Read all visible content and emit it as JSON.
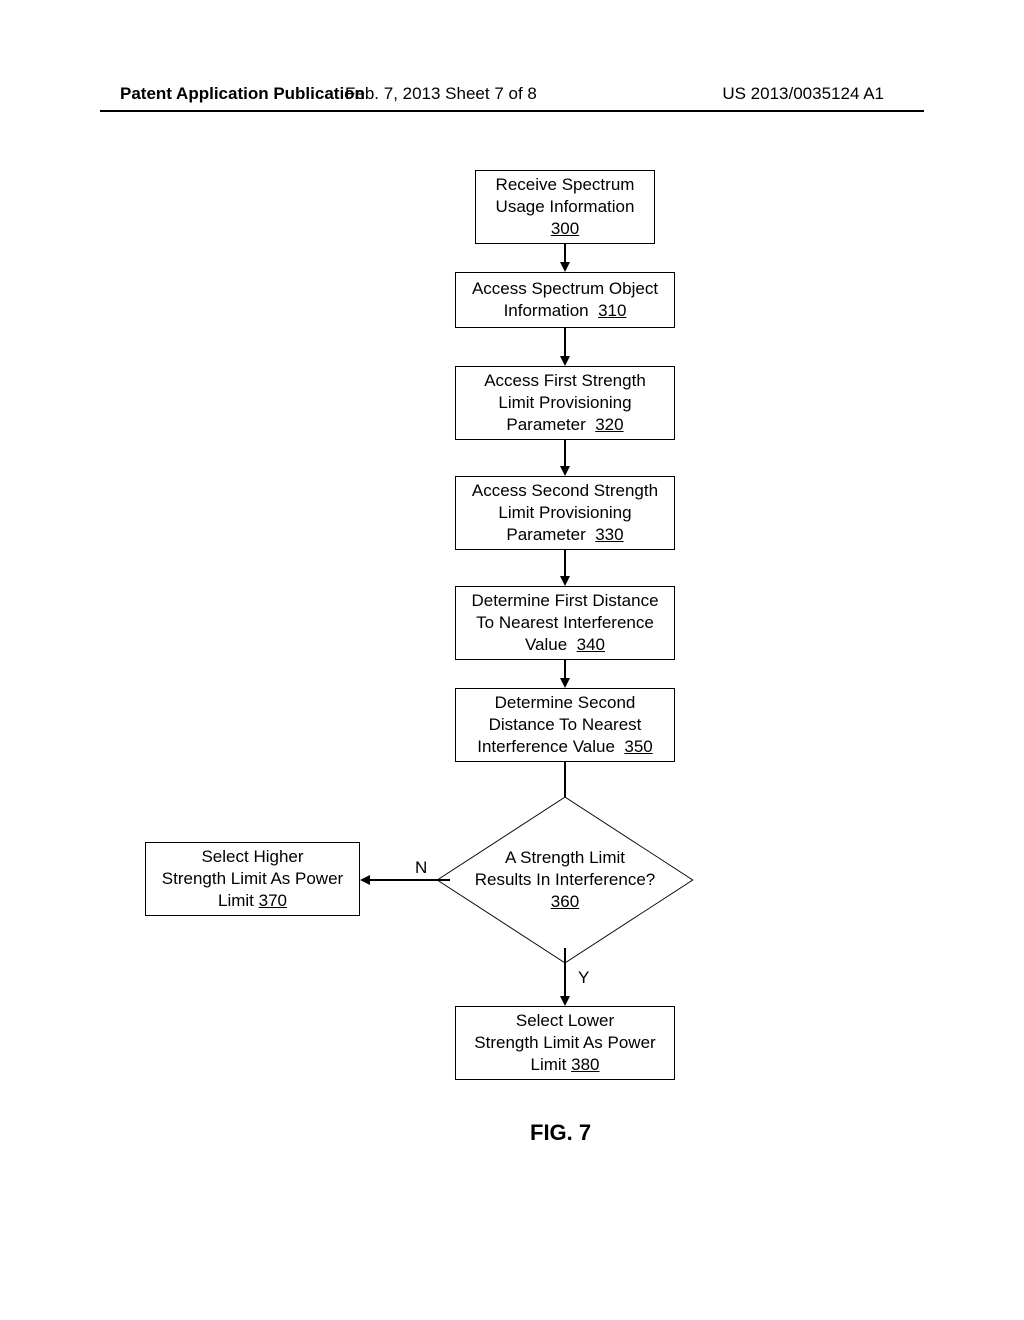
{
  "header": {
    "left": "Patent Application Publication",
    "center": "Feb. 7, 2013  Sheet 7 of 8",
    "right": "US 2013/0035124 A1"
  },
  "boxes": {
    "b300": {
      "l1": "Receive Spectrum",
      "l2": "Usage Information",
      "ref": "300"
    },
    "b310": {
      "l1": "Access Spectrum Object",
      "l2": "Information",
      "ref": "310"
    },
    "b320": {
      "l1": "Access First Strength",
      "l2": "Limit Provisioning",
      "l3": "Parameter",
      "ref": "320"
    },
    "b330": {
      "l1": "Access Second Strength",
      "l2": "Limit Provisioning",
      "l3": "Parameter",
      "ref": "330"
    },
    "b340": {
      "l1": "Determine First Distance",
      "l2": "To Nearest Interference",
      "l3": "Value",
      "ref": "340"
    },
    "b350": {
      "l1": "Determine Second",
      "l2": "Distance To Nearest",
      "l3": "Interference Value",
      "ref": "350"
    },
    "b370": {
      "l1": "Select Higher",
      "l2": "Strength Limit As Power",
      "l3": "Limit",
      "ref": "370"
    },
    "b380": {
      "l1": "Select Lower",
      "l2": "Strength Limit As Power",
      "l3": "Limit",
      "ref": "380"
    }
  },
  "decision": {
    "l1": "A Strength Limit",
    "l2": "Results In Interference?",
    "ref": "360",
    "yes": "Y",
    "no": "N"
  },
  "figure_label": "FIG. 7"
}
